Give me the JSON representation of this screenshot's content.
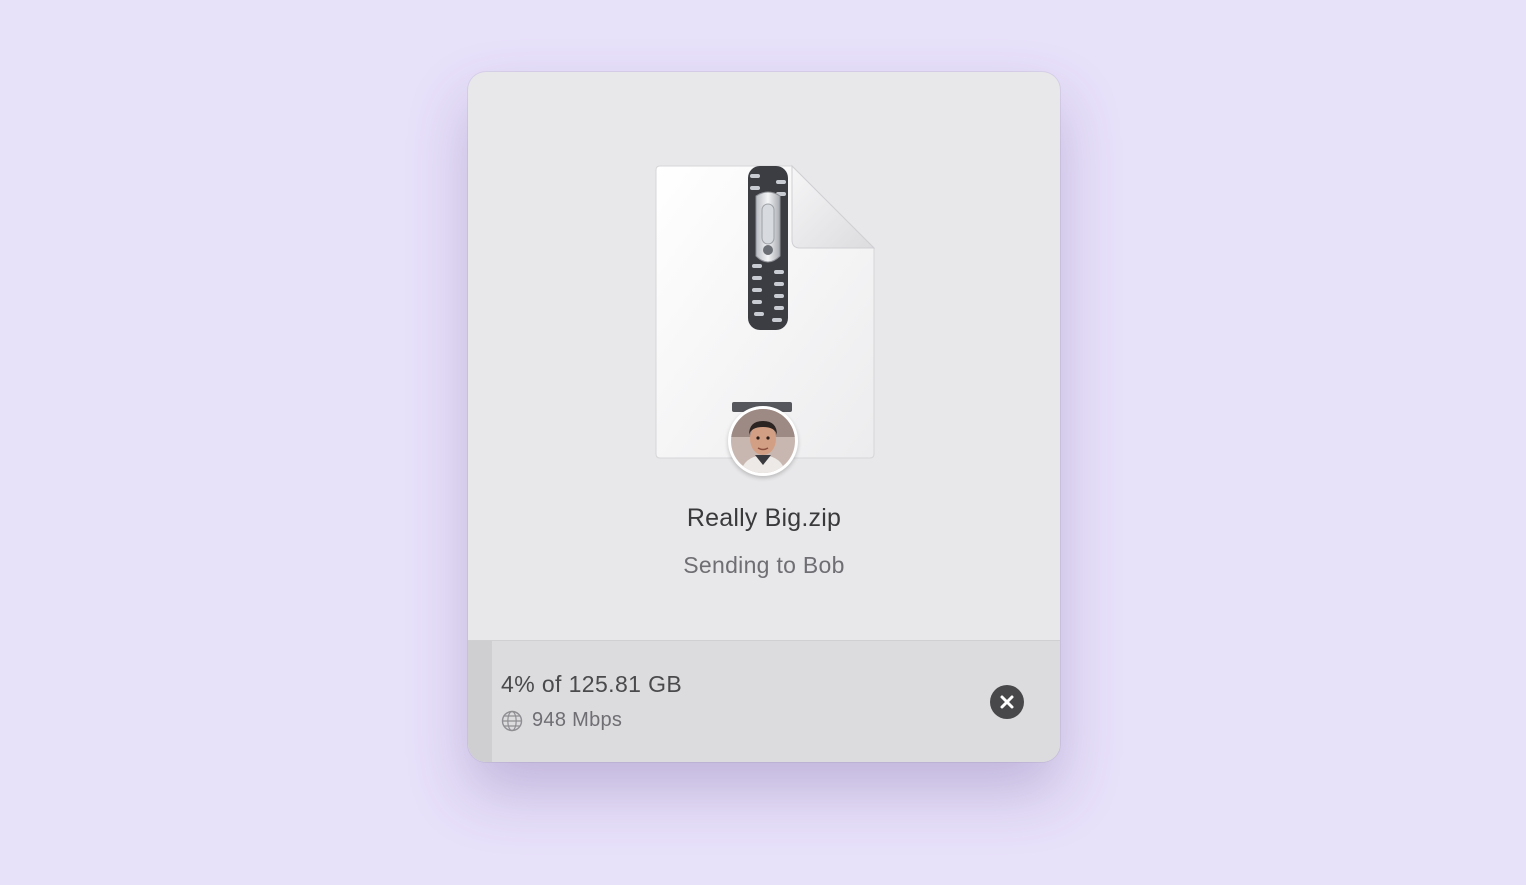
{
  "transfer": {
    "file_name": "Really Big.zip",
    "status": "Sending to Bob",
    "progress_text": "4% of 125.81 GB",
    "progress_fraction": 0.04,
    "speed": "948 Mbps"
  },
  "icons": {
    "file": "zip-file-icon",
    "avatar": "recipient-avatar",
    "network": "globe-icon",
    "cancel": "close-icon"
  },
  "colors": {
    "background": "#e8e1fa",
    "dialog": "#e8e8ea",
    "footer": "#dcdcde",
    "cancel_button": "#48484a"
  }
}
